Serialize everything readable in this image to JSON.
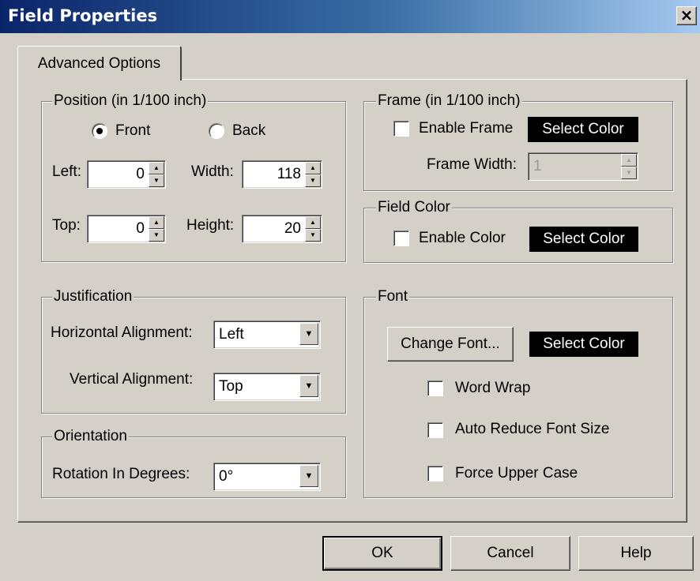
{
  "window": {
    "title": "Field Properties",
    "close_glyph": "×"
  },
  "tab": {
    "label": "Advanced Options"
  },
  "position": {
    "legend": "Position (in 1/100 inch)",
    "front_label": "Front",
    "back_label": "Back",
    "selected_side": "Front",
    "left_label": "Left:",
    "left_value": "0",
    "top_label": "Top:",
    "top_value": "0",
    "width_label": "Width:",
    "width_value": "118",
    "height_label": "Height:",
    "height_value": "20"
  },
  "frame": {
    "legend": "Frame (in 1/100 inch)",
    "enable_label": "Enable Frame",
    "enable_checked": false,
    "select_color_label": "Select Color",
    "width_label": "Frame Width:",
    "width_value": "1"
  },
  "field_color": {
    "legend": "Field Color",
    "enable_label": "Enable Color",
    "enable_checked": false,
    "select_color_label": "Select Color"
  },
  "justification": {
    "legend": "Justification",
    "horizontal_label": "Horizontal Alignment:",
    "horizontal_value": "Left",
    "vertical_label": "Vertical Alignment:",
    "vertical_value": "Top"
  },
  "orientation": {
    "legend": "Orientation",
    "rotation_label": "Rotation In Degrees:",
    "rotation_value": "0°"
  },
  "font": {
    "legend": "Font",
    "change_font_label": "Change Font...",
    "select_color_label": "Select Color",
    "word_wrap_label": "Word Wrap",
    "auto_reduce_label": "Auto Reduce Font Size",
    "force_upper_label": "Force Upper Case"
  },
  "buttons": {
    "ok": "OK",
    "cancel": "Cancel",
    "help": "Help"
  },
  "colors": {
    "titlebar_start": "#0a246a",
    "titlebar_end": "#a6caf0",
    "dialog_bg": "#d4d0c8",
    "color_swatch_bg": "#000000"
  },
  "icons": {
    "close": "close-icon",
    "spin_up": "arrow-up-icon",
    "spin_down": "arrow-down-icon",
    "dropdown": "chevron-down-icon"
  }
}
